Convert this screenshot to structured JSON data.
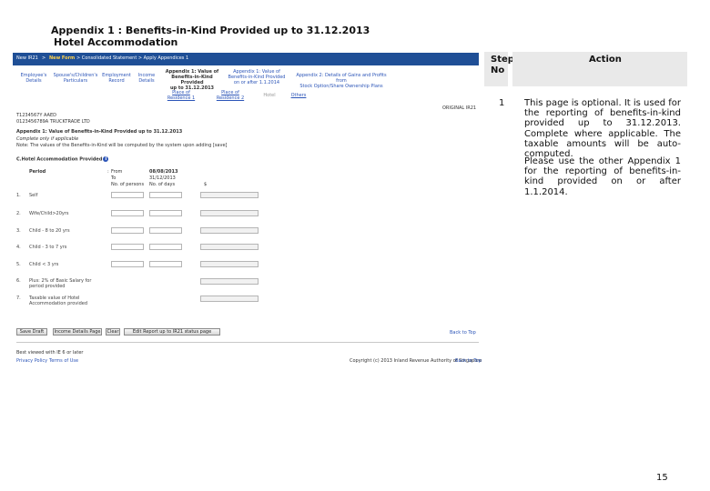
{
  "document": {
    "title": "Appendix 1 : Benefits-in-Kind Provided up to 31.12.2013",
    "subtitle": "Hotel Accommodation",
    "page_number": "15"
  },
  "table": {
    "step_header": "Step No",
    "action_header": "Action",
    "rows": [
      {
        "step": "1",
        "action_p1": "This page is optional. It is used for the reporting of benefits-in-kind provided up to 31.12.2013. Complete where applicable. The taxable amounts will be auto-computed.",
        "action_p2": "Please use the other Appendix 1 for the reporting of benefits-in-kind provided on or after 1.1.2014."
      }
    ]
  },
  "screen": {
    "breadcrumb": {
      "home": "New IR21",
      "sep1": ">",
      "current": "New Form",
      "sep2": "> Consolidated Statement > Apply Appendices 1"
    },
    "nav_tabs": [
      {
        "label": "Employee's\nDetails",
        "active": false
      },
      {
        "label": "Spouse's/Children's\nParticulars",
        "active": false
      },
      {
        "label": "Employment\nRecord",
        "active": false
      },
      {
        "label": "Income\nDetails",
        "active": false
      },
      {
        "label": "Appendix 1: Value of\nBenefits-in-Kind Provided\nup to 31.12.2013",
        "active": true
      },
      {
        "label": "Appendix 1: Value of\nBenefits-in-Kind Provided\non or after 1.1.2014",
        "active": false
      },
      {
        "label": "Appendix 2: Details of Gains and Profits from\nStock Option/Share Ownership Plans",
        "active": false
      }
    ],
    "sub_tabs": [
      {
        "label": "Place of\nResidence 1",
        "active": false
      },
      {
        "label": "Place of\nResidence 2",
        "active": false
      },
      {
        "label": "Hotel",
        "active": true
      },
      {
        "label": "Others",
        "active": false
      }
    ],
    "original_label": "ORIGINAL IR21",
    "employee_line1": "T1234567Y     AAED",
    "employee_line2": "0123456789A   TRUCKTRADE LTD",
    "section_title": "Appendix 1: Value of Benefits-in-Kind Provided up to 31.12.2013",
    "complete_note": "Complete only if applicable",
    "note": "Note: The values of the Benefits-in-Kind will be computed by the system upon adding [save]",
    "hotel_heading": "C.Hotel Accommodation Provided",
    "period_label": "Period",
    "colon": ":",
    "from_label": "From",
    "from_value": "08/08/2013",
    "to_label": "To",
    "to_value": "31/12/2013",
    "col_persons": "No. of persons",
    "col_days": "No. of days",
    "col_rate": "$",
    "rows": [
      {
        "no": "1.",
        "label": "Self"
      },
      {
        "no": "2.",
        "label": "Wife/Child>20yrs"
      },
      {
        "no": "3.",
        "label": "Child - 8 to 20 yrs"
      },
      {
        "no": "4.",
        "label": "Child - 3 to 7 yrs"
      },
      {
        "no": "5.",
        "label": "Child < 3 yrs"
      },
      {
        "no": "6.",
        "label": "Plus: 2% of Basic Salary for\nperiod provided"
      },
      {
        "no": "7.",
        "label": "Taxable value of Hotel\nAccommodation provided"
      }
    ],
    "buttons": {
      "save_draft": "Save Draft",
      "income_details": "Income Details Page",
      "clear": "Clear",
      "edit_report": "Edit Report up to IR21 status page"
    },
    "back_to_top": "Back to Top",
    "back_to_top_2": "Back to Top",
    "footer_left": "Best viewed with IE 6 or later",
    "privacy": "Privacy Policy",
    "terms": "Terms of Use",
    "copyright": "Copyright (c) 2013 Inland Revenue Authority of Singapore"
  },
  "colors": {
    "topbar": "#1f4f96",
    "link": "#2c55b8",
    "header_bg": "#e9e9e9"
  }
}
